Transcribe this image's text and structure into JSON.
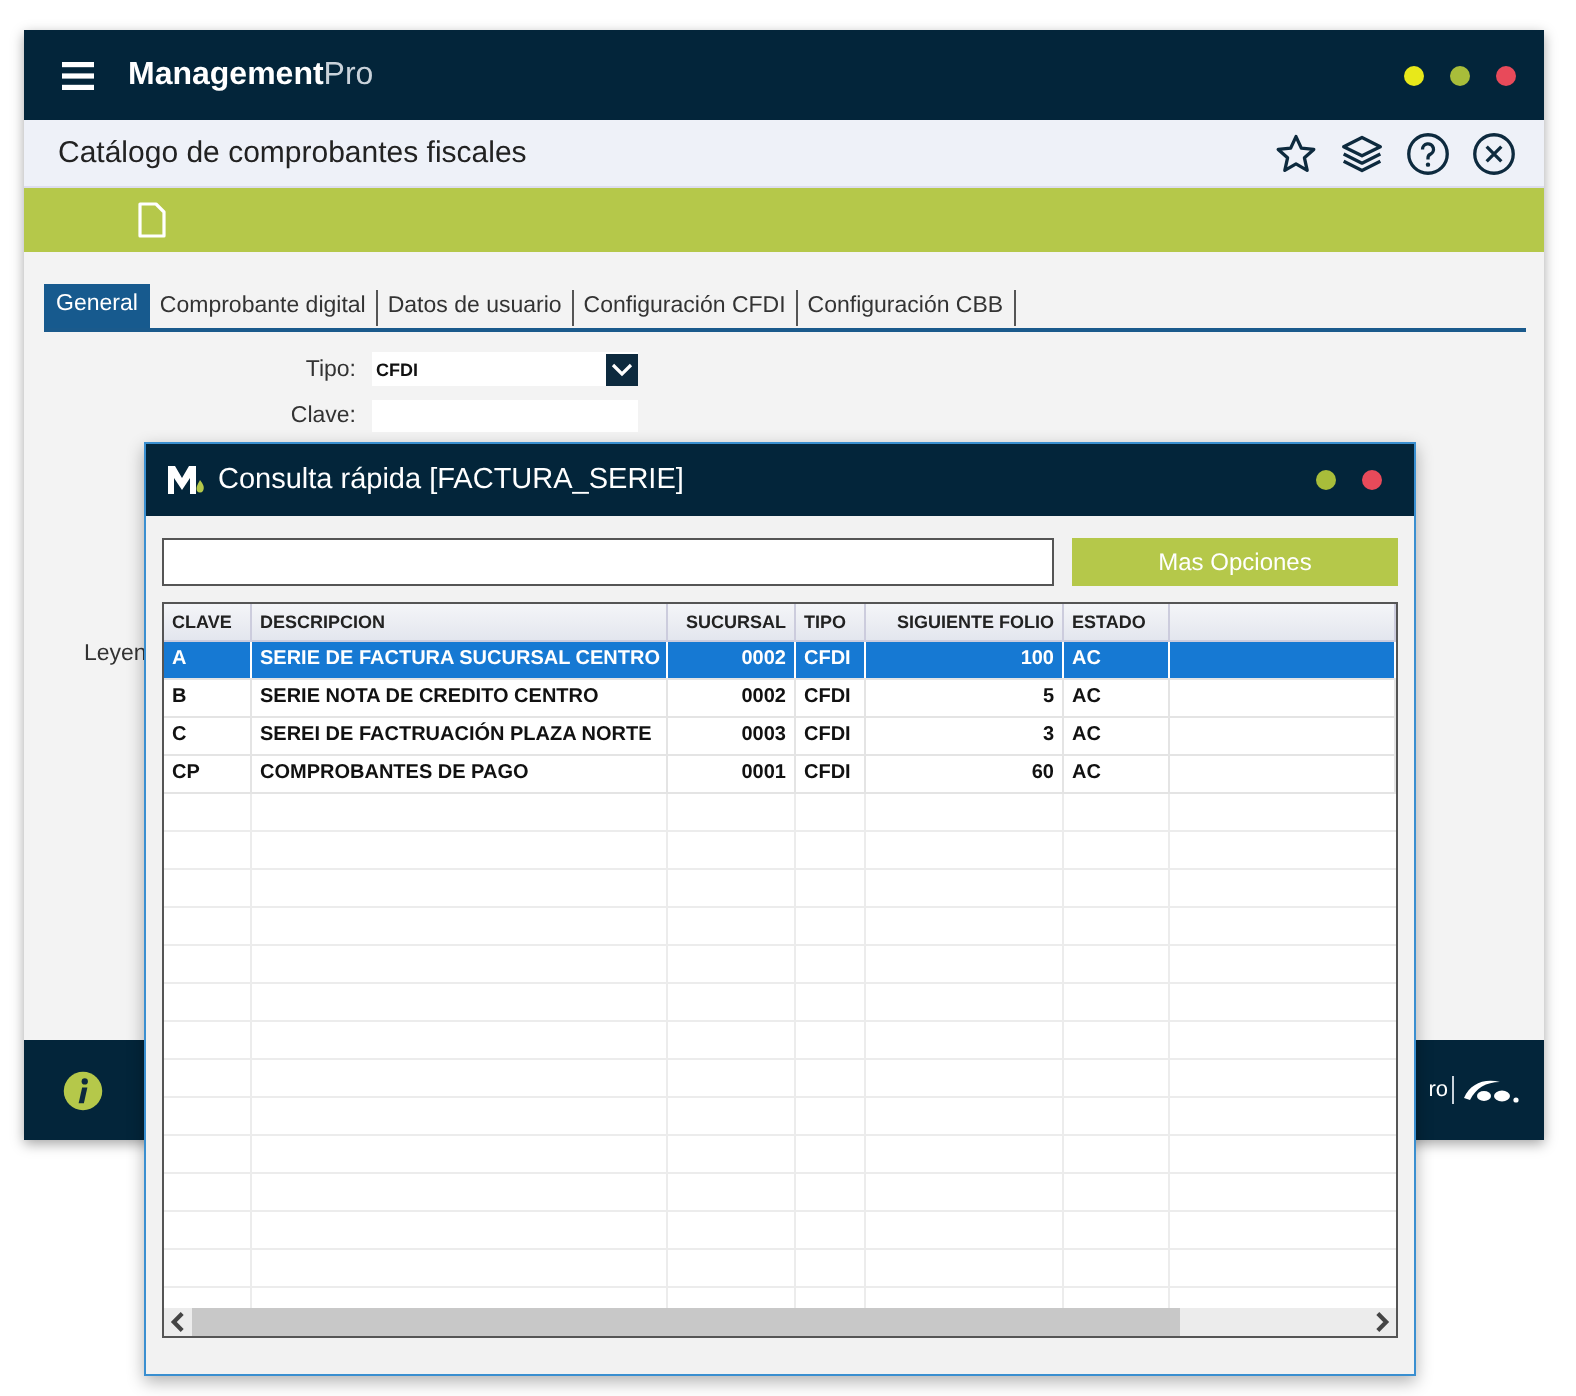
{
  "main_window": {
    "app_name": {
      "bold": "Management",
      "light": "Pro"
    },
    "title": "Catálogo de comprobantes fiscales",
    "tabs": [
      {
        "label": "General",
        "selected": true
      },
      {
        "label": "Comprobante digital",
        "selected": false
      },
      {
        "label": "Datos de usuario",
        "selected": false
      },
      {
        "label": "Configuración CFDI",
        "selected": false
      },
      {
        "label": "Configuración CBB",
        "selected": false
      }
    ],
    "fields": [
      {
        "label": "Tipo:",
        "kind": "select",
        "value": "CFDI"
      },
      {
        "label": "Clave:",
        "kind": "text"
      }
    ],
    "partial_label": "Leyen",
    "footer_text": "ro"
  },
  "dialog": {
    "title": "Consulta rápida [FACTURA_SERIE]",
    "button": "Mas Opciones",
    "table": {
      "columns": [
        "CLAVE",
        "DESCRIPCION",
        "SUCURSAL",
        "TIPO",
        "SIGUIENTE FOLIO",
        "ESTADO"
      ],
      "rows": [
        {
          "cells": [
            "A",
            "SERIE DE FACTURA SUCURSAL CENTRO",
            "0002",
            "CFDI",
            "100",
            "AC"
          ],
          "selected": true
        },
        {
          "cells": [
            "B",
            "SERIE NOTA DE CREDITO CENTRO",
            "0002",
            "CFDI",
            "5",
            "AC"
          ],
          "selected": false
        },
        {
          "cells": [
            "C",
            "SEREI DE FACTRUACIÓN PLAZA NORTE",
            "0003",
            "CFDI",
            "3",
            "AC"
          ],
          "selected": false
        },
        {
          "cells": [
            "CP",
            "COMPROBANTES DE PAGO",
            "0001",
            "CFDI",
            "60",
            "AC"
          ],
          "selected": false
        }
      ]
    }
  }
}
